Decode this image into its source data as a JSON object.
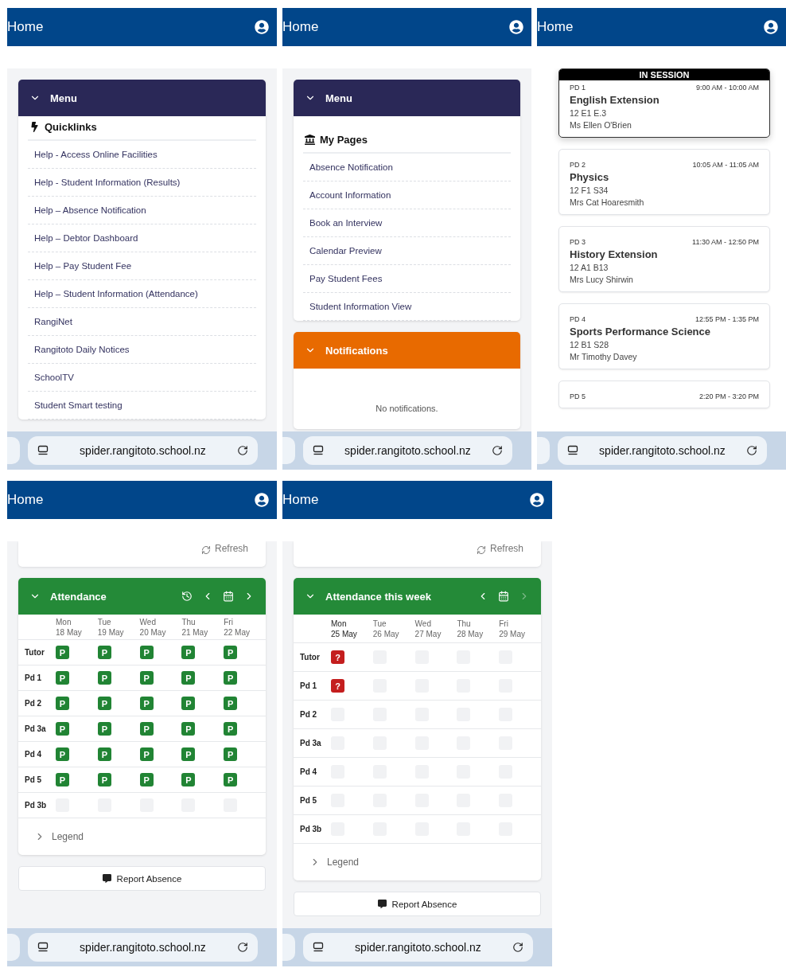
{
  "screens": [
    {
      "title": "Home",
      "url": "spider.rangitoto.school.nz",
      "blocks": [
        {
          "kind": "quicklinks",
          "title": "Menu",
          "expanded": true,
          "heading": "Quicklinks",
          "links": [
            "Help - Access Online Facilities",
            "Help - Student Information (Results)",
            "Help – Absence Notification",
            "Help – Debtor Dashboard",
            "Help – Pay Student Fee",
            "Help – Student Information (Attendance)",
            "RangiNet",
            "Rangitoto Daily Notices",
            "SchoolTV",
            "Student Smart testing"
          ]
        }
      ]
    },
    {
      "title": "Home",
      "url": "spider.rangitoto.school.nz",
      "blocks": [
        {
          "kind": "pages",
          "title": "Menu",
          "expanded": true,
          "heading": "My Pages",
          "links": [
            "Absence Notification",
            "Account Information",
            "Book an Interview",
            "Calendar Preview",
            "Pay Student Fees",
            "Student Information View"
          ]
        },
        {
          "kind": "notifications",
          "title": "Notifications",
          "expanded": true,
          "message": "No notifications."
        }
      ]
    },
    {
      "title": "Home",
      "url": "spider.rangitoto.school.nz",
      "blocks": [
        {
          "kind": "timetable",
          "periods": [
            {
              "period": "PD 1",
              "time": "9:00 AM - 10:00 AM",
              "subject": "English Extension",
              "room": "12 E1 E.3",
              "teacher": "Ms Ellen O'Brien",
              "in_session": true,
              "badge": "IN SESSION"
            },
            {
              "period": "PD 2",
              "time": "10:05 AM - 11:05 AM",
              "subject": "Physics",
              "room": "12 F1 S34",
              "teacher": "Mrs Cat Hoaresmith",
              "in_session": false
            },
            {
              "period": "PD 3",
              "time": "11:30 AM - 12:50 PM",
              "subject": "History Extension",
              "room": "12 A1 B13",
              "teacher": "Mrs Lucy Shirwin",
              "in_session": false
            },
            {
              "period": "PD 4",
              "time": "12:55 PM - 1:35 PM",
              "subject": "Sports Performance Science",
              "room": "12 B1 S28",
              "teacher": "Mr Timothy Davey",
              "in_session": false
            },
            {
              "period": "PD 5",
              "time": "2:20 PM - 3:20 PM",
              "in_session": false
            }
          ]
        }
      ]
    },
    {
      "title": "Home",
      "url": "spider.rangitoto.school.nz",
      "blocks": [
        {
          "kind": "refresh",
          "label": "Refresh"
        },
        {
          "kind": "attendance",
          "title": "Attendance",
          "expanded": true,
          "history_button": true,
          "next_disabled": false,
          "days": [
            {
              "day": "Mon",
              "date": "18 May"
            },
            {
              "day": "Tue",
              "date": "19 May"
            },
            {
              "day": "Wed",
              "date": "20 May"
            },
            {
              "day": "Thu",
              "date": "21 May"
            },
            {
              "day": "Fri",
              "date": "22 May"
            }
          ],
          "rows": [
            {
              "label": "Tutor",
              "cells": [
                {
                  "kind": "present",
                  "text": "P"
                },
                {
                  "kind": "present",
                  "text": "P"
                },
                {
                  "kind": "present",
                  "text": "P"
                },
                {
                  "kind": "present",
                  "text": "P"
                },
                {
                  "kind": "present",
                  "text": "P"
                }
              ]
            },
            {
              "label": "Pd 1",
              "cells": [
                {
                  "kind": "present",
                  "text": "P"
                },
                {
                  "kind": "present",
                  "text": "P"
                },
                {
                  "kind": "present",
                  "text": "P"
                },
                {
                  "kind": "present",
                  "text": "P"
                },
                {
                  "kind": "present",
                  "text": "P"
                }
              ]
            },
            {
              "label": "Pd 2",
              "cells": [
                {
                  "kind": "present",
                  "text": "P"
                },
                {
                  "kind": "present",
                  "text": "P"
                },
                {
                  "kind": "present",
                  "text": "P"
                },
                {
                  "kind": "present",
                  "text": "P"
                },
                {
                  "kind": "present",
                  "text": "P"
                }
              ]
            },
            {
              "label": "Pd 3a",
              "cells": [
                {
                  "kind": "present",
                  "text": "P"
                },
                {
                  "kind": "present",
                  "text": "P"
                },
                {
                  "kind": "present",
                  "text": "P"
                },
                {
                  "kind": "present",
                  "text": "P"
                },
                {
                  "kind": "present",
                  "text": "P"
                }
              ]
            },
            {
              "label": "Pd 4",
              "cells": [
                {
                  "kind": "present",
                  "text": "P"
                },
                {
                  "kind": "present",
                  "text": "P"
                },
                {
                  "kind": "present",
                  "text": "P"
                },
                {
                  "kind": "present",
                  "text": "P"
                },
                {
                  "kind": "present",
                  "text": "P"
                }
              ]
            },
            {
              "label": "Pd 5",
              "cells": [
                {
                  "kind": "present",
                  "text": "P"
                },
                {
                  "kind": "present",
                  "text": "P"
                },
                {
                  "kind": "present",
                  "text": "P"
                },
                {
                  "kind": "present",
                  "text": "P"
                },
                {
                  "kind": "present",
                  "text": "P"
                }
              ]
            },
            {
              "label": "Pd 3b",
              "cells": [
                {
                  "kind": "empty"
                },
                {
                  "kind": "empty"
                },
                {
                  "kind": "empty"
                },
                {
                  "kind": "empty"
                },
                {
                  "kind": "empty"
                }
              ]
            }
          ],
          "legend": {
            "label": "Legend",
            "expanded": false
          }
        },
        {
          "kind": "report",
          "label": "Report Absence"
        }
      ]
    },
    {
      "title": "Home",
      "url": "spider.rangitoto.school.nz",
      "blocks": [
        {
          "kind": "refresh",
          "label": "Refresh"
        },
        {
          "kind": "attendance",
          "title": "Attendance this week",
          "expanded": true,
          "history_button": false,
          "next_disabled": true,
          "days": [
            {
              "day": "Mon",
              "date": "25 May"
            },
            {
              "day": "Tue",
              "date": "26 May"
            },
            {
              "day": "Wed",
              "date": "27 May"
            },
            {
              "day": "Thu",
              "date": "28 May"
            },
            {
              "day": "Fri",
              "date": "29 May"
            }
          ],
          "rows": [
            {
              "label": "Tutor",
              "cells": [
                {
                  "kind": "unknown",
                  "text": "?"
                },
                {
                  "kind": "empty"
                },
                {
                  "kind": "empty"
                },
                {
                  "kind": "empty"
                },
                {
                  "kind": "empty"
                }
              ]
            },
            {
              "label": "Pd 1",
              "cells": [
                {
                  "kind": "unknown",
                  "text": "?"
                },
                {
                  "kind": "empty"
                },
                {
                  "kind": "empty"
                },
                {
                  "kind": "empty"
                },
                {
                  "kind": "empty"
                }
              ]
            },
            {
              "label": "Pd 2",
              "cells": [
                {
                  "kind": "empty"
                },
                {
                  "kind": "empty"
                },
                {
                  "kind": "empty"
                },
                {
                  "kind": "empty"
                },
                {
                  "kind": "empty"
                }
              ]
            },
            {
              "label": "Pd 3a",
              "cells": [
                {
                  "kind": "empty"
                },
                {
                  "kind": "empty"
                },
                {
                  "kind": "empty"
                },
                {
                  "kind": "empty"
                },
                {
                  "kind": "empty"
                }
              ]
            },
            {
              "label": "Pd 4",
              "cells": [
                {
                  "kind": "empty"
                },
                {
                  "kind": "empty"
                },
                {
                  "kind": "empty"
                },
                {
                  "kind": "empty"
                },
                {
                  "kind": "empty"
                }
              ]
            },
            {
              "label": "Pd 5",
              "cells": [
                {
                  "kind": "empty"
                },
                {
                  "kind": "empty"
                },
                {
                  "kind": "empty"
                },
                {
                  "kind": "empty"
                },
                {
                  "kind": "empty"
                }
              ]
            },
            {
              "label": "Pd 3b",
              "cells": [
                {
                  "kind": "empty"
                },
                {
                  "kind": "empty"
                },
                {
                  "kind": "empty"
                },
                {
                  "kind": "empty"
                },
                {
                  "kind": "empty"
                }
              ]
            }
          ],
          "legend": {
            "label": "Legend",
            "expanded": false
          }
        },
        {
          "kind": "report",
          "label": "Report Absence"
        }
      ]
    }
  ]
}
